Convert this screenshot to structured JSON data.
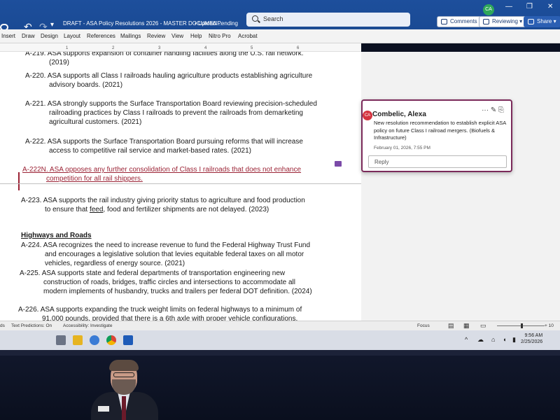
{
  "titlebar": {
    "doc_title": "DRAFT - ASA Policy Resolutions 2026 - MASTER DOCUMEN...",
    "upload_status": "• Upload Pending",
    "search_placeholder": "Search",
    "avatar_initials": "CA",
    "minimize": "—",
    "restore": "❐",
    "close": "✕",
    "undo": "↶",
    "redo": "↷",
    "more": "▾"
  },
  "ribbon": {
    "tabs": [
      "Insert",
      "Draw",
      "Design",
      "Layout",
      "References",
      "Mailings",
      "Review",
      "View",
      "Help",
      "Nitro Pro",
      "Acrobat"
    ],
    "comments_button": "Comments",
    "mode_button": "Reviewing ▾",
    "share_button": "Share ▾"
  },
  "ruler": {
    "ticks": [
      "1",
      "2",
      "3",
      "4",
      "5",
      "6"
    ]
  },
  "document": {
    "paragraphs": [
      {
        "num": "A-219.",
        "text": "ASA supports expansion of container handling facilities along the U.S. rail network.",
        "cont": "(2019)"
      },
      {
        "num": "A-220.",
        "text": "ASA supports all Class I railroads hauling agriculture products establishing agriculture",
        "cont": "advisory boards. (2021)"
      },
      {
        "num": "A-221.",
        "text": "ASA strongly supports the Surface Transportation Board reviewing precision-scheduled",
        "cont": "railroading practices by Class I railroads to prevent the railroads from demarketing",
        "cont2": "agricultural customers. (2021)"
      },
      {
        "num": "A-222.",
        "text": "ASA supports the Surface Transportation Board pursuing reforms that will increase",
        "cont": "access to competitive rail service and market-based rates. (2021)"
      },
      {
        "num": "A-222N.",
        "text": "ASA opposes any further consolidation of Class I railroads that does not enhance",
        "cont": "competition for all rail shippers."
      },
      {
        "num": "A-223.",
        "text": "ASA supports the rail industry giving priority status to agriculture and food production",
        "cont_pre": "to ensure that ",
        "cont_link": "feed",
        "cont_post": ", food and fertilizer shipments are not delayed. (2023)"
      },
      {
        "num": "A-224.",
        "text": "ASA recognizes the need to increase revenue to fund the Federal Highway Trust Fund",
        "cont": "and encourages a legislative solution that levies equitable federal taxes on all motor",
        "cont2": "vehicles, regardless of energy source. (2021)"
      },
      {
        "num": "A-225.",
        "text": "ASA supports state and federal departments of transportation engineering new",
        "cont": "construction of roads, bridges, traffic circles and intersections to accommodate all",
        "cont2": "modern implements of husbandry, trucks and trailers per federal DOT definition. (2024)"
      },
      {
        "num": "A-226.",
        "text": "ASA supports expanding the truck weight limits on federal highways to a minimum of",
        "cont": "91,000 pounds, provided that there is a 6th axle with proper vehicle configurations."
      }
    ],
    "heading": "Highways and Roads"
  },
  "comment": {
    "initials": "CA",
    "author": "Combelic, Alexa",
    "actions": "···  ✎  ⎘",
    "body": "New resolution recommendation to establish explicit ASA policy on future Class I railroad mergers. (Biofuels & Infrastructure)",
    "date": "February 01, 2026, 7:55 PM",
    "reply_placeholder": "Reply"
  },
  "statusbar": {
    "left1": "ds",
    "text_predictions": "Text Predictions: On",
    "accessibility": "Accessibility: Investigate",
    "focus": "Focus",
    "zoom": "+ 10"
  },
  "taskbar": {
    "tray_up": "^",
    "time": "9:56 AM",
    "date": "2/25/2026"
  },
  "colors": {
    "titlebar": "#1d4f9c",
    "insertion": "#9b2335",
    "comment_border": "#7b2a5a",
    "author_avatar": "#d4333f"
  }
}
